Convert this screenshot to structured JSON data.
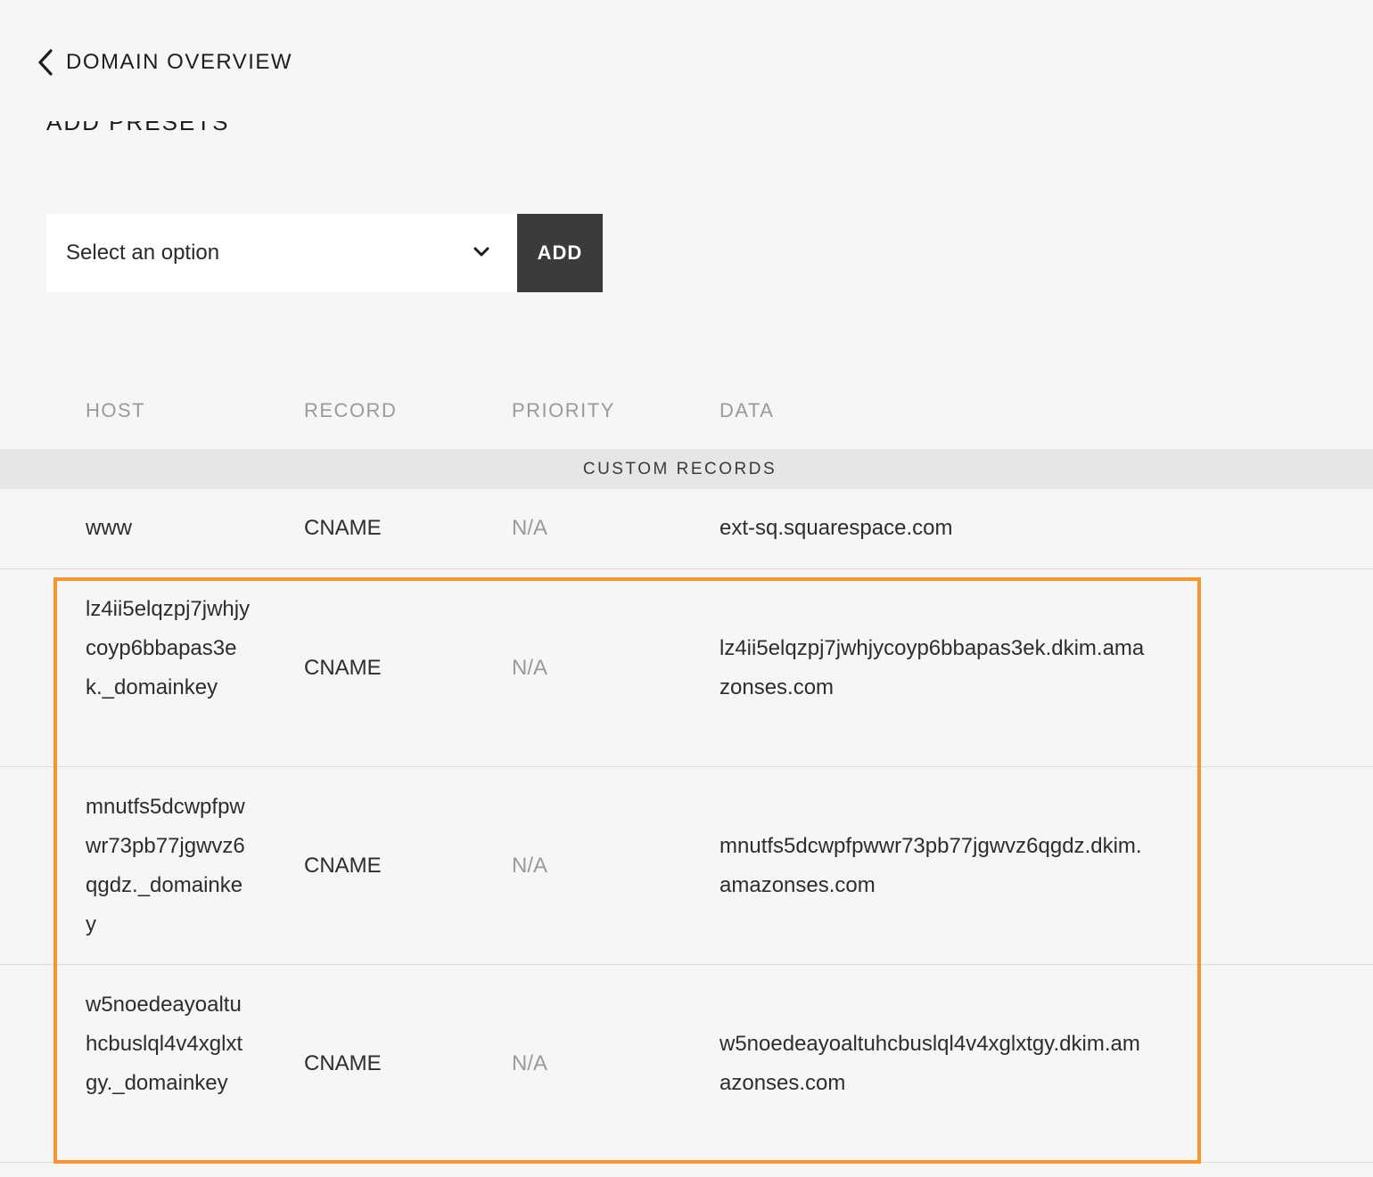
{
  "nav": {
    "back_label": "DOMAIN OVERVIEW"
  },
  "presets": {
    "heading": "ADD PRESETS",
    "select_value": "Select an option",
    "add_label": "ADD"
  },
  "table": {
    "columns": {
      "host": "HOST",
      "record": "RECORD",
      "priority": "PRIORITY",
      "data": "DATA"
    },
    "section_label": "CUSTOM RECORDS",
    "rows": [
      {
        "host": "www",
        "record": "CNAME",
        "priority": "N/A",
        "data": "ext-sq.squarespace.com"
      },
      {
        "host": "lz4ii5elqzpj7jwhjycoyp6bbapas3ek._domainkey",
        "record": "CNAME",
        "priority": "N/A",
        "data": "lz4ii5elqzpj7jwhjycoyp6bbapas3ek.dkim.amazonses.com"
      },
      {
        "host": "mnutfs5dcwpfpwwr73pb77jgwvz6qgdz._domainkey",
        "record": "CNAME",
        "priority": "N/A",
        "data": "mnutfs5dcwpfpwwr73pb77jgwvz6qgdz.dkim.amazonses.com"
      },
      {
        "host": "w5noedeayoaltuhcbuslql4v4xglxtgy._domainkey",
        "record": "CNAME",
        "priority": "N/A",
        "data": "w5noedeayoaltuhcbuslql4v4xglxtgy.dkim.amazonses.com"
      }
    ]
  },
  "icons": {
    "back": "chevron-left-icon",
    "select": "chevron-down-icon"
  },
  "colors": {
    "background": "#f6f6f6",
    "button": "#3b3b3b",
    "section_bar": "#e6e6e6",
    "highlight": "#f5962e",
    "muted_text": "#9a9a9a"
  }
}
